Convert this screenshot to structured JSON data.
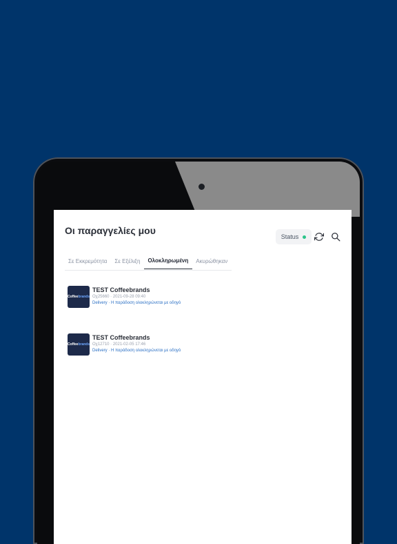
{
  "screen": {
    "title": "Οι παραγγελίες μου",
    "status_label": "Status"
  },
  "colors": {
    "background": "#00346a",
    "status_dot": "#2bc48a",
    "link": "#2a6fc4"
  },
  "icons": {
    "refresh": "refresh-icon",
    "search": "search-icon"
  },
  "tabs": [
    {
      "label": "Σε Εκκρεμότητα",
      "active": false
    },
    {
      "label": "Σε Εξέλιξη",
      "active": false
    },
    {
      "label": "Ολοκληρωμένη",
      "active": true
    },
    {
      "label": "Ακυρώθηκαν",
      "active": false
    }
  ],
  "orders": [
    {
      "store": "TEST Coffeebrands",
      "meta": "Οχ25660 · 2021-09-28 09:40",
      "note": "Delivery · Η παράδοση ολοκληρώνεται με οδηγό",
      "logo_text": "Coffee",
      "logo_accent": "brands"
    },
    {
      "store": "TEST Coffeebrands",
      "meta": "Οχ12710 · 2021-02-05 17:46",
      "note": "Delivery · Η παράδοση ολοκληρώνεται με οδηγό",
      "logo_text": "Coffee",
      "logo_accent": "brands"
    }
  ]
}
